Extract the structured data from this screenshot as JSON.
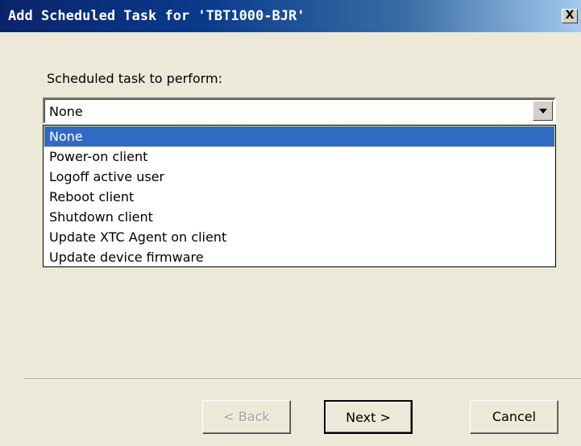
{
  "window": {
    "title": "Add Scheduled Task for 'TBT1000-BJR'",
    "close_glyph": "X"
  },
  "form": {
    "label": "Scheduled task to perform:",
    "selected_value": "None",
    "options": [
      "None",
      "Power-on client",
      "Logoff active user",
      "Reboot client",
      "Shutdown client",
      "Update XTC Agent on client",
      "Update device firmware"
    ]
  },
  "buttons": {
    "back": "< Back",
    "next": "Next >",
    "cancel": "Cancel"
  },
  "colors": {
    "selection": "#316ac5",
    "dialog_bg": "#ece9d8",
    "titlebar_start": "#0a246a",
    "titlebar_end": "#a6caf0"
  },
  "icons": {
    "close": "close-icon",
    "dropdown_arrow": "chevron-down-icon"
  }
}
